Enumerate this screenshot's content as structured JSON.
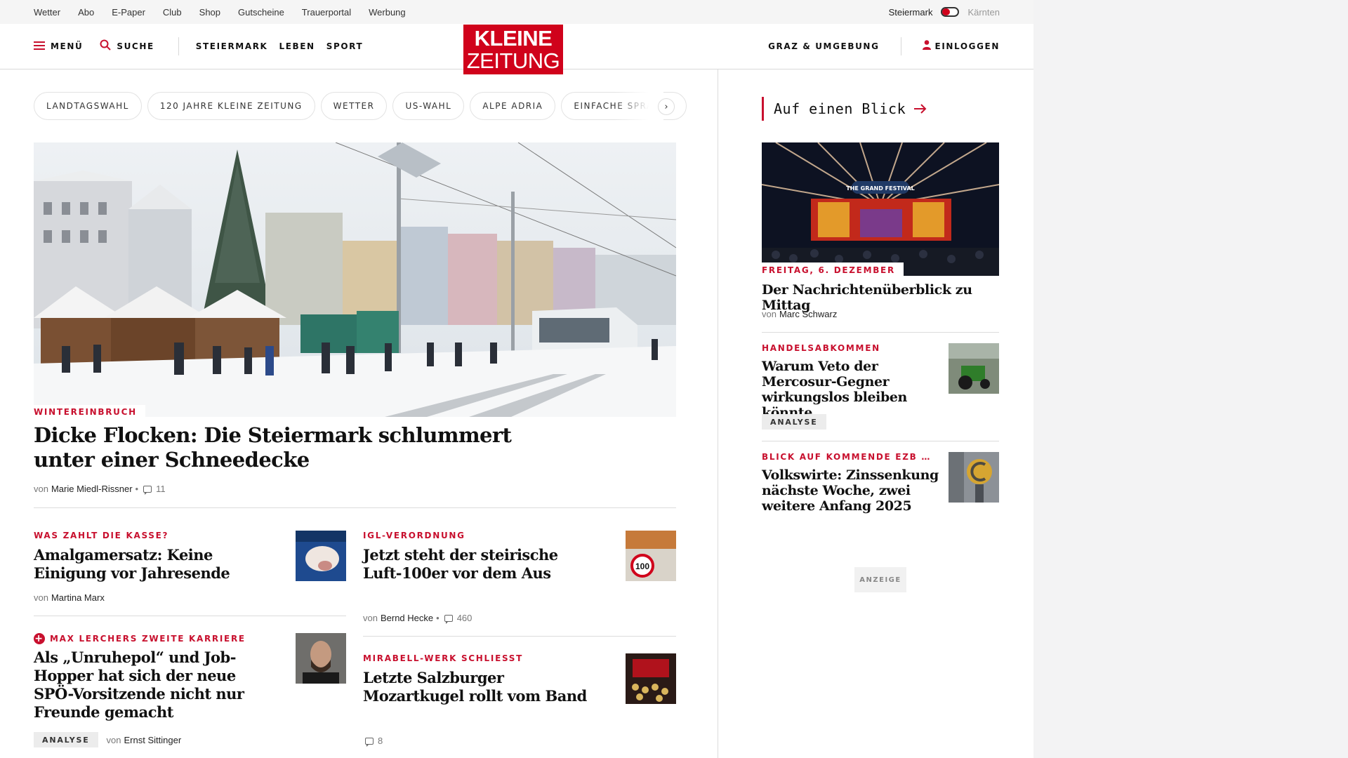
{
  "utility": {
    "links": [
      "Wetter",
      "Abo",
      "E-Paper",
      "Club",
      "Shop",
      "Gutscheine",
      "Trauerportal",
      "Werbung"
    ],
    "region_active": "Steiermark",
    "region_inactive": "Kärnten"
  },
  "header": {
    "menu": "MENÜ",
    "search": "SUCHE",
    "nav": [
      "STEIERMARK",
      "LEBEN",
      "SPORT"
    ],
    "logo_line1": "KLEINE",
    "logo_line2": "ZEITUNG",
    "region_link": "GRAZ & UMGEBUNG",
    "login": "EINLOGGEN"
  },
  "tags": [
    "LANDTAGSWAHL",
    "120 JAHRE KLEINE ZEITUNG",
    "WETTER",
    "US-WAHL",
    "ALPE ADRIA",
    "EINFACHE SPRACHE"
  ],
  "hero": {
    "kicker": "WINTEREINBRUCH",
    "title": "Dicke Flocken: Die Steiermark schlummert unter einer Schneedecke",
    "by": "von",
    "author": "Marie Miedl-Rissner",
    "sep": "•",
    "comments": "11"
  },
  "articles": [
    {
      "kicker": "WAS ZAHLT DIE KASSE?",
      "title": "Amalgamersatz: Keine Einigung vor Jahresende",
      "by": "von",
      "author": "Martina Marx"
    },
    {
      "kicker": "IGL-VERORDNUNG",
      "title": "Jetzt steht der steirische Luft-100er vor dem Aus",
      "by": "von",
      "author": "Bernd Hecke",
      "sep": "•",
      "comments": "460"
    },
    {
      "kicker": "MAX LERCHERS ZWEITE KARRIERE",
      "title": "Als „Unruhepol“ und Job-Hopper hat sich der neue SPÖ-Vorsitzende nicht nur Freunde gemacht",
      "badge": "ANALYSE",
      "by": "von",
      "author": "Ernst Sittinger"
    },
    {
      "kicker": "MIRABELL-WERK SCHLIESST",
      "title": "Letzte Salzburger Mozartkugel rollt vom Band",
      "comments": "8"
    }
  ],
  "sidebar": {
    "heading": "Auf einen Blick",
    "lead": {
      "date": "FREITAG, 6. DEZEMBER",
      "title": "Der Nachrichtenüberblick zu Mittag",
      "by": "von",
      "author": "Marc Schwarz",
      "image_text": "THE GRAND FESTIVAL"
    },
    "items": [
      {
        "kicker": "HANDELSABKOMMEN",
        "title": "Warum Veto der Mercosur-Gegner wirkungslos bleiben könnte",
        "badge": "ANALYSE"
      },
      {
        "kicker": "BLICK AUF KOMMENDE EZB …",
        "title": "Volkswirte: Zinssenkung nächste Woche, zwei weitere Anfang 2025"
      }
    ],
    "ad": "ANZEIGE"
  },
  "thumb_text": {
    "speed_sign": "100"
  },
  "colors": {
    "brand_red": "#d0021b",
    "kicker_red": "#c8102e"
  }
}
